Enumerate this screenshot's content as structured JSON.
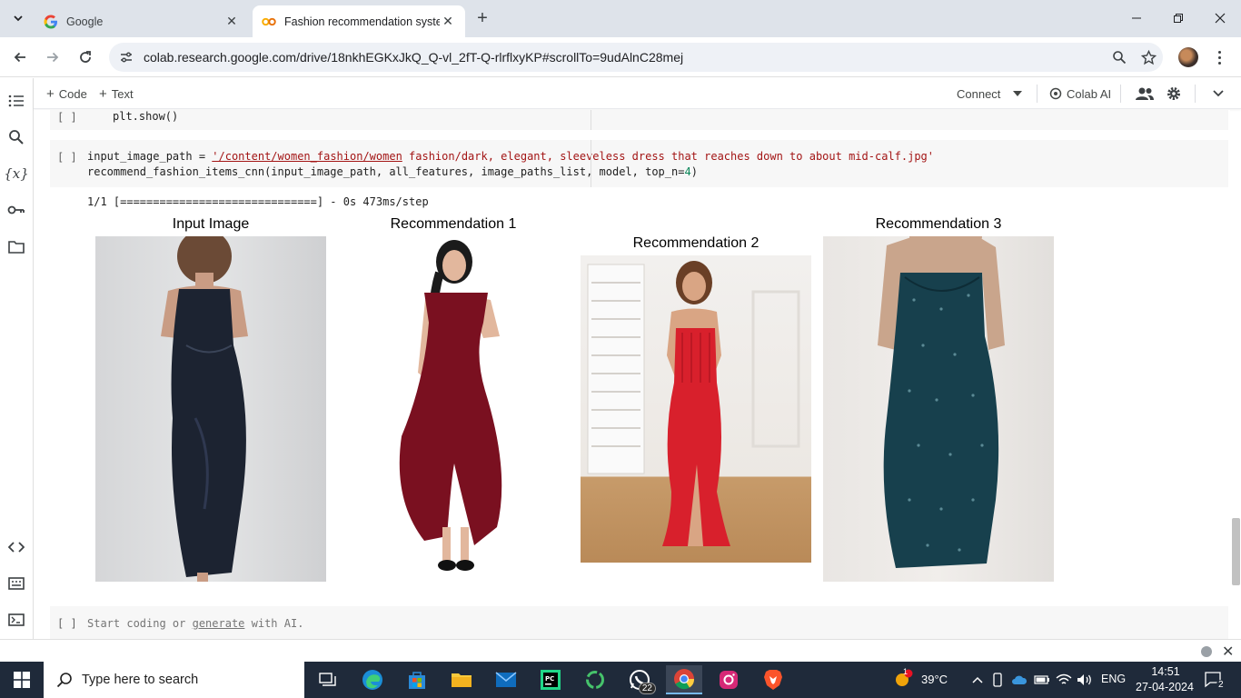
{
  "browser": {
    "tabs": [
      {
        "label": "Google",
        "favicon": "google-g-icon",
        "active": false
      },
      {
        "label": "Fashion recommendation syste",
        "favicon": "colab-co-icon",
        "active": true
      }
    ],
    "url": "colab.research.google.com/drive/18nkhEGKxJkQ_Q-vl_2fT-Q-rlrflxyKP#scrollTo=9udAlnC28mej"
  },
  "colab": {
    "toolbar": {
      "code_label": "Code",
      "text_label": "Text",
      "connect_label": "Connect",
      "colab_ai_label": "Colab AI"
    },
    "cells": {
      "cell1": {
        "run_indicator": "[ ]",
        "code": "plt.show()"
      },
      "cell2": {
        "run_indicator": "[ ]",
        "line1_var": "input_image_path = ",
        "line1_str_underlined": "'/content/women_fashion/women",
        "line1_str_rest": " fashion/dark, elegant, sleeveless dress that reaches down to about mid-calf.jpg'",
        "line2_pre": "recommend_fashion_items_cnn(input_image_path, all_features, image_paths_list, model, top_n=",
        "line2_num": "4",
        "line2_post": ")",
        "output": "1/1 [==============================] - 0s 473ms/step"
      },
      "cell3": {
        "run_indicator": "[ ]",
        "placeholder_pre": "Start coding or ",
        "placeholder_link": "generate",
        "placeholder_post": " with AI."
      }
    },
    "figure": {
      "panels": [
        {
          "title": "Input Image",
          "dress_color": "#1c2331"
        },
        {
          "title": "Recommendation 1",
          "dress_color": "#7a1020"
        },
        {
          "title": "Recommendation 2",
          "dress_color": "#d8202c"
        },
        {
          "title": "Recommendation 3",
          "dress_color": "#17404d"
        }
      ]
    }
  },
  "taskbar": {
    "search_placeholder": "Type here to search",
    "weather": "39°C",
    "weather_badge": "1",
    "language": "ENG",
    "time": "14:51",
    "date": "27-04-2024",
    "whatsapp_badge": "22",
    "notification_count": "2"
  }
}
